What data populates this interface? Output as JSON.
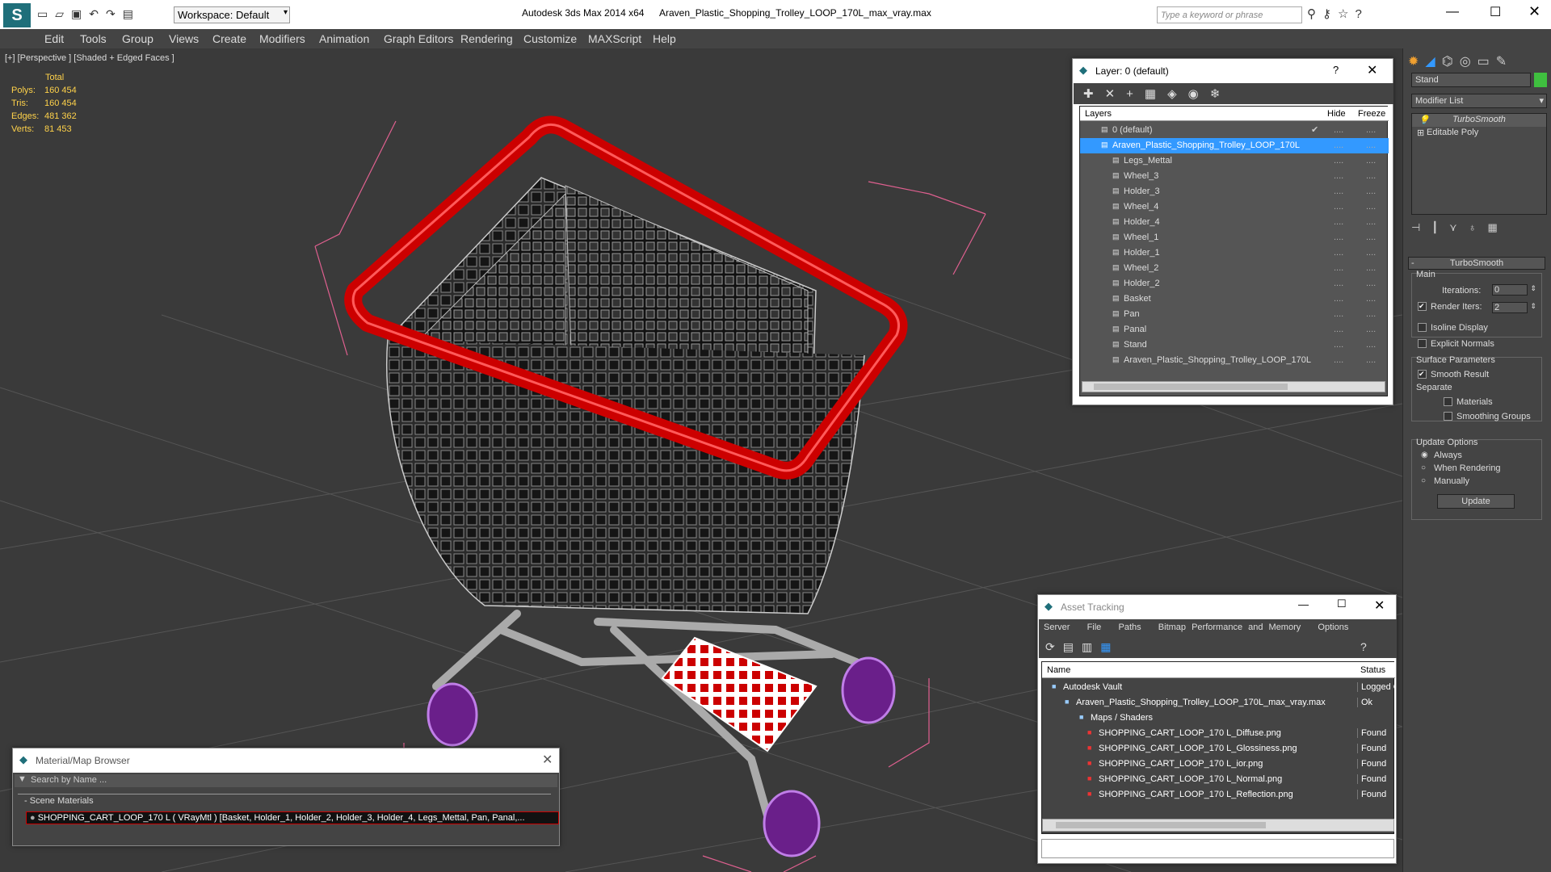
{
  "titlebar": {
    "workspace": "Workspace: Default",
    "app": "Autodesk 3ds Max  2014 x64",
    "file": "Araven_Plastic_Shopping_Trolley_LOOP_170L_max_vray.max",
    "search_placeholder": "Type a keyword or phrase"
  },
  "menu": [
    "Edit",
    "Tools",
    "Group",
    "Views",
    "Create",
    "Modifiers",
    "Animation",
    "Graph Editors",
    "Rendering",
    "Customize",
    "MAXScript",
    "Help"
  ],
  "viewport": {
    "label": "[+] [Perspective ] [Shaded + Edged Faces ]",
    "stats": {
      "header": "Total",
      "rows": [
        {
          "k": "Polys:",
          "v": "160 454"
        },
        {
          "k": "Tris:",
          "v": "160 454"
        },
        {
          "k": "Edges:",
          "v": "481 362"
        },
        {
          "k": "Verts:",
          "v": "81 453"
        }
      ]
    }
  },
  "layer_dialog": {
    "title": "Layer: 0 (default)",
    "help": "?",
    "col_layers": "Layers",
    "col_hide": "Hide",
    "col_freeze": "Freeze",
    "rows": [
      "0 (default)",
      "Araven_Plastic_Shopping_Trolley_LOOP_170L",
      "Legs_Mettal",
      "Wheel_3",
      "Holder_3",
      "Wheel_4",
      "Holder_4",
      "Wheel_1",
      "Holder_1",
      "Wheel_2",
      "Holder_2",
      "Basket",
      "Pan",
      "Panal",
      "Stand",
      "Araven_Plastic_Shopping_Trolley_LOOP_170L"
    ]
  },
  "material_browser": {
    "title": "Material/Map Browser",
    "search_placeholder": "Search by Name ...",
    "group": "Scene Materials",
    "item": "SHOPPING_CART_LOOP_170 L  ( VRayMtl ) [Basket, Holder_1, Holder_2, Holder_3, Holder_4, Legs_Mettal, Pan, Panal,..."
  },
  "asset_tracking": {
    "title": "Asset Tracking",
    "menu": [
      "Server",
      "File",
      "Paths",
      "Bitmap Performance and Memory",
      "Options"
    ],
    "col_name": "Name",
    "col_status": "Status",
    "rows": [
      {
        "name": "Autodesk Vault",
        "status": "Logged O"
      },
      {
        "name": "Araven_Plastic_Shopping_Trolley_LOOP_170L_max_vray.max",
        "status": "Ok"
      },
      {
        "name": "Maps / Shaders",
        "status": ""
      },
      {
        "name": "SHOPPING_CART_LOOP_170 L_Diffuse.png",
        "status": "Found"
      },
      {
        "name": "SHOPPING_CART_LOOP_170 L_Glossiness.png",
        "status": "Found"
      },
      {
        "name": "SHOPPING_CART_LOOP_170 L_ior.png",
        "status": "Found"
      },
      {
        "name": "SHOPPING_CART_LOOP_170 L_Normal.png",
        "status": "Found"
      },
      {
        "name": "SHOPPING_CART_LOOP_170 L_Reflection.png",
        "status": "Found"
      }
    ]
  },
  "command_panel": {
    "object_name": "Stand",
    "modifier_list": "Modifier List",
    "stack": [
      "TurboSmooth",
      "Editable Poly"
    ],
    "rollout": "TurboSmooth",
    "main": "Main",
    "iterations_label": "Iterations:",
    "iterations": "0",
    "render_iters_label": "Render Iters:",
    "render_iters": "2",
    "isoline": "Isoline Display",
    "explicit": "Explicit Normals",
    "surface": "Surface Parameters",
    "smooth_result": "Smooth Result",
    "separate": "Separate",
    "materials": "Materials",
    "smoothing_groups": "Smoothing Groups",
    "update_options": "Update Options",
    "always": "Always",
    "when_rendering": "When Rendering",
    "manually": "Manually",
    "update": "Update"
  },
  "colors": {
    "accent_blue": "#3399ff",
    "basket_red": "#cc0000",
    "wheel_purple": "#9933cc",
    "stats_yellow": "#ffd24a"
  }
}
